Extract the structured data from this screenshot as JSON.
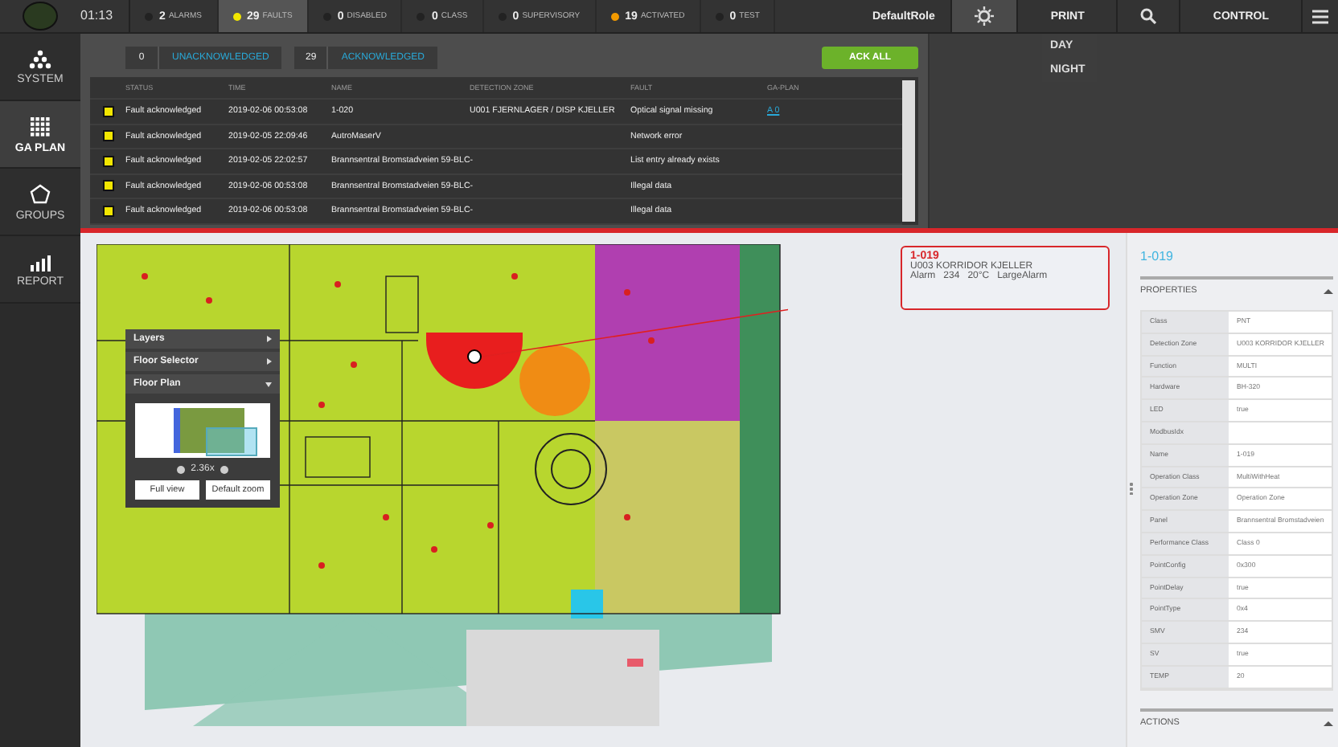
{
  "top_bar": {
    "time": "01:13",
    "counters": [
      {
        "count": "2",
        "label": "ALARMS",
        "color": "#222222",
        "selected": false
      },
      {
        "count": "29",
        "label": "FAULTS",
        "color": "#f2e600",
        "selected": true
      },
      {
        "count": "0",
        "label": "DISABLED",
        "color": "#222222",
        "selected": false
      },
      {
        "count": "0",
        "label": "CLASS",
        "color": "#222222",
        "selected": false
      },
      {
        "count": "0",
        "label": "SUPERVISORY",
        "color": "#222222",
        "selected": false
      },
      {
        "count": "19",
        "label": "ACTIVATED",
        "color": "#f29a00",
        "selected": false
      },
      {
        "count": "0",
        "label": "TEST",
        "color": "#222222",
        "selected": false
      }
    ],
    "role": "DefaultRole",
    "print": "PRINT",
    "control": "CONTROL",
    "theme_menu": [
      "DAY",
      "NIGHT"
    ]
  },
  "sidebar": {
    "items": [
      {
        "label": "SYSTEM",
        "selected": false
      },
      {
        "label": "GA PLAN",
        "selected": true
      },
      {
        "label": "GROUPS",
        "selected": false
      },
      {
        "label": "REPORT",
        "selected": false
      }
    ]
  },
  "filters": [
    {
      "count": "0",
      "label": "UNACKNOWLEDGED"
    },
    {
      "count": "29",
      "label": "ACKNOWLEDGED"
    }
  ],
  "ack_all": "ACK ALL",
  "table": {
    "columns": [
      "STATUS",
      "TIME",
      "NAME",
      "DETECTION ZONE",
      "FAULT",
      "GA-PLAN"
    ],
    "rows": [
      {
        "status": "Fault acknowledged",
        "time": "2019-02-06 00:53:08",
        "name": "1-020",
        "zone": "U001 FJERNLAGER / DISP KJELLER",
        "fault": "Optical signal missing",
        "ga_plan": "A 0"
      },
      {
        "status": "Fault acknowledged",
        "time": "2019-02-05 22:09:46",
        "name": "AutroMaserV",
        "fault": "Network error"
      },
      {
        "status": "Fault acknowledged",
        "time": "2019-02-05 22:02:57",
        "name": "Brannsentral Bromstadveien 59-BLC-",
        "fault": "List entry already exists"
      },
      {
        "status": "Fault acknowledged",
        "time": "2019-02-06 00:53:08",
        "name": "Brannsentral Bromstadveien 59-BLC-",
        "fault": "Illegal data"
      },
      {
        "status": "Fault acknowledged",
        "time": "2019-02-06 00:53:08",
        "name": "Brannsentral Bromstadveien 59-BLC-",
        "fault": "Illegal data"
      }
    ]
  },
  "callout": {
    "title": "1-019",
    "zone": "U003 KORRIDOR KJELLER",
    "readings": [
      "Alarm",
      "234",
      "20°C",
      "LargeAlarm"
    ]
  },
  "map_panel": {
    "sections": [
      {
        "label": "Layers",
        "expanded": false
      },
      {
        "label": "Floor Selector",
        "expanded": false
      },
      {
        "label": "Floor Plan",
        "expanded": true
      }
    ],
    "zoom": "2.36x",
    "buttons": [
      "Full view",
      "Default zoom"
    ]
  },
  "details": {
    "title": "1-019",
    "section": "PROPERTIES",
    "properties": [
      {
        "key": "Class",
        "value": "PNT"
      },
      {
        "key": "Detection Zone",
        "value": "U003 KORRIDOR KJELLER"
      },
      {
        "key": "Function",
        "value": "MULTI"
      },
      {
        "key": "Hardware",
        "value": "BH-320"
      },
      {
        "key": "LED",
        "value": "true"
      },
      {
        "key": "ModbusIdx"
      },
      {
        "key": "Name",
        "value": "1-019"
      },
      {
        "key": "Operation Class",
        "value": "MultiWithHeat"
      },
      {
        "key": "Operation Zone",
        "value": "Operation Zone"
      },
      {
        "key": "Panel",
        "value": "Brannsentral Bromstadveien"
      },
      {
        "key": "Performance Class",
        "value": "Class 0"
      },
      {
        "key": "PointConfig",
        "value": "0x300"
      },
      {
        "key": "PointDelay",
        "value": "true"
      },
      {
        "key": "PointType",
        "value": "0x4"
      },
      {
        "key": "SMV",
        "value": "234"
      },
      {
        "key": "SV",
        "value": "true"
      },
      {
        "key": "TEMP",
        "value": "20"
      }
    ],
    "actions": "ACTIONS"
  }
}
